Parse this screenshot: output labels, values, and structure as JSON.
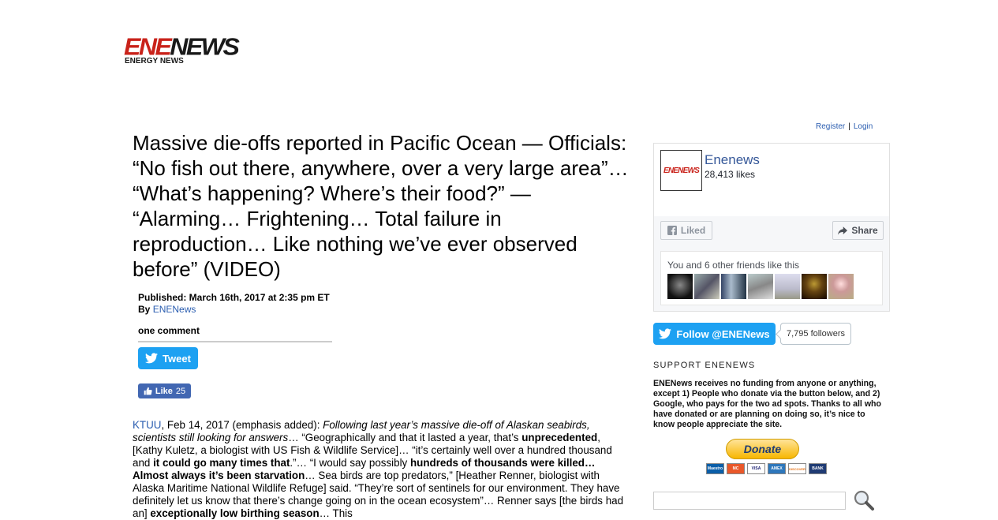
{
  "logo": {
    "ene": "ENE",
    "news": "NEWS",
    "sub": "ENERGY NEWS"
  },
  "account": {
    "register": "Register",
    "separator": "|",
    "login": "Login"
  },
  "article": {
    "headline": "Massive die-offs reported in Pacific Ocean — Officials: “No fish out there, anywhere, over a very large area”… “What’s happening? Where’s their food?” — “Alarming… Frightening… Total failure in reproduction… Like nothing we’ve ever observed before” (VIDEO)",
    "published": "Published: March 16th, 2017 at 2:35 pm ET",
    "by_label": "By",
    "author": "ENENews",
    "comments": "one comment",
    "tweet_label": "Tweet",
    "like_label": "Like",
    "like_count": "25",
    "body": {
      "source": "KTUU",
      "t1": ", Feb 14, 2017 (emphasis added): ",
      "i1": "Following last year’s massive die-off of Alaskan seabirds, scientists still looking for answers",
      "t2": "… “Geographically and that it lasted a year, that’s ",
      "b1": "unprecedented",
      "t3": ", [Kathy Kuletz, a biologist with US Fish & Wildlife Service]… “it’s certainly well over a hundred thousand and ",
      "b2": "it could go many times that",
      "t4": ".”… “I would say possibly ",
      "b3": "hundreds of thousands were killed… Almost always it’s been starvation",
      "t5": "… Sea birds are top predators,” [Heather Renner, biologist with Alaska Maritime National Wildlife Refuge] said. “They’re sort of sentinels for our environment. They have definitely let us know that there’s change going on in the ocean ecosystem”… Renner says [the birds had an] ",
      "b4": "exceptionally low birthing season",
      "t6": "… This"
    }
  },
  "facebook": {
    "page_name": "Enenews",
    "likes": "28,413 likes",
    "liked_label": "Liked",
    "share_label": "Share",
    "friends_text": "You and 6 other friends like this",
    "avatar_text": "ENENEWS"
  },
  "twitter": {
    "follow_label": "Follow @ENENews",
    "followers": "7,795 followers"
  },
  "support": {
    "title": "SUPPORT ENENEWS",
    "text": "ENENews receives no funding from anyone or anything, except 1) People who donate via the button below, and 2) Google, who pays for the two ad spots. Thanks to all who have donated or are planning on doing so, it’s nice to know people appreciate the site.",
    "donate_label": "Donate",
    "cards": [
      "Maestro",
      "MC",
      "VISA",
      "AMEX",
      "DISCOVER",
      "BANK"
    ]
  },
  "colors": {
    "brand_red": "#c9221a",
    "twitter_blue": "#1da1f2",
    "facebook_blue": "#4267b2",
    "link": "#2a5db0"
  }
}
